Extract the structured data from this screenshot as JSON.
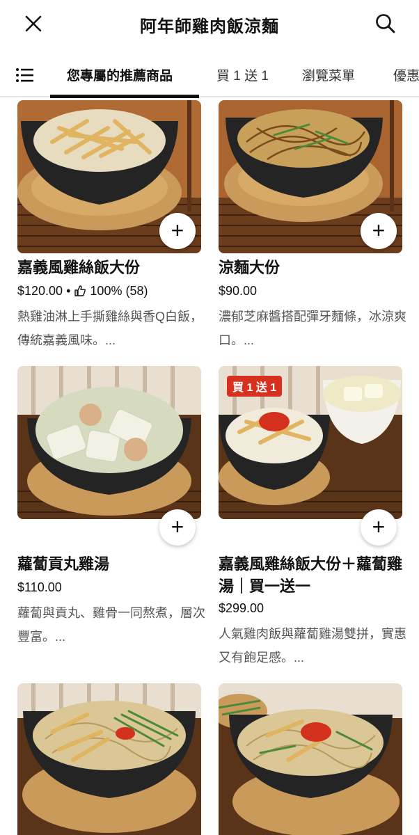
{
  "header": {
    "title": "阿年師雞肉飯涼麵"
  },
  "tabs": [
    "您專屬的推薦商品",
    "買 1 送 1",
    "瀏覽菜單",
    "優惠"
  ],
  "products": [
    {
      "name": "嘉義風雞絲飯大份",
      "price": "$120.00",
      "rating": "100% (58)",
      "description": "熱雞油淋上手撕雞絲與香Q白飯，傳統嘉義風味。..."
    },
    {
      "name": "涼麵大份",
      "price": "$90.00",
      "description": "濃郁芝麻醬搭配彈牙麵條，冰涼爽口。..."
    },
    {
      "name": "蘿蔔貢丸雞湯",
      "price": "$110.00",
      "description": "蘿蔔與貢丸、雞骨一同熬煮，層次豐富。..."
    },
    {
      "name": "嘉義風雞絲飯大份＋蘿蔔雞湯｜買一送一",
      "price": "$299.00",
      "badge": "買 1 送 1",
      "description": "人氣雞肉飯與蘿蔔雞湯雙拼，實惠又有飽足感。..."
    }
  ],
  "colors": {
    "badge": "#d7301f",
    "tab_underline": "#111111"
  },
  "icons": {
    "close": "close-icon",
    "search": "search-icon",
    "menu": "menu-list-icon",
    "add": "plus-icon",
    "rating": "thumbs-up-icon"
  }
}
